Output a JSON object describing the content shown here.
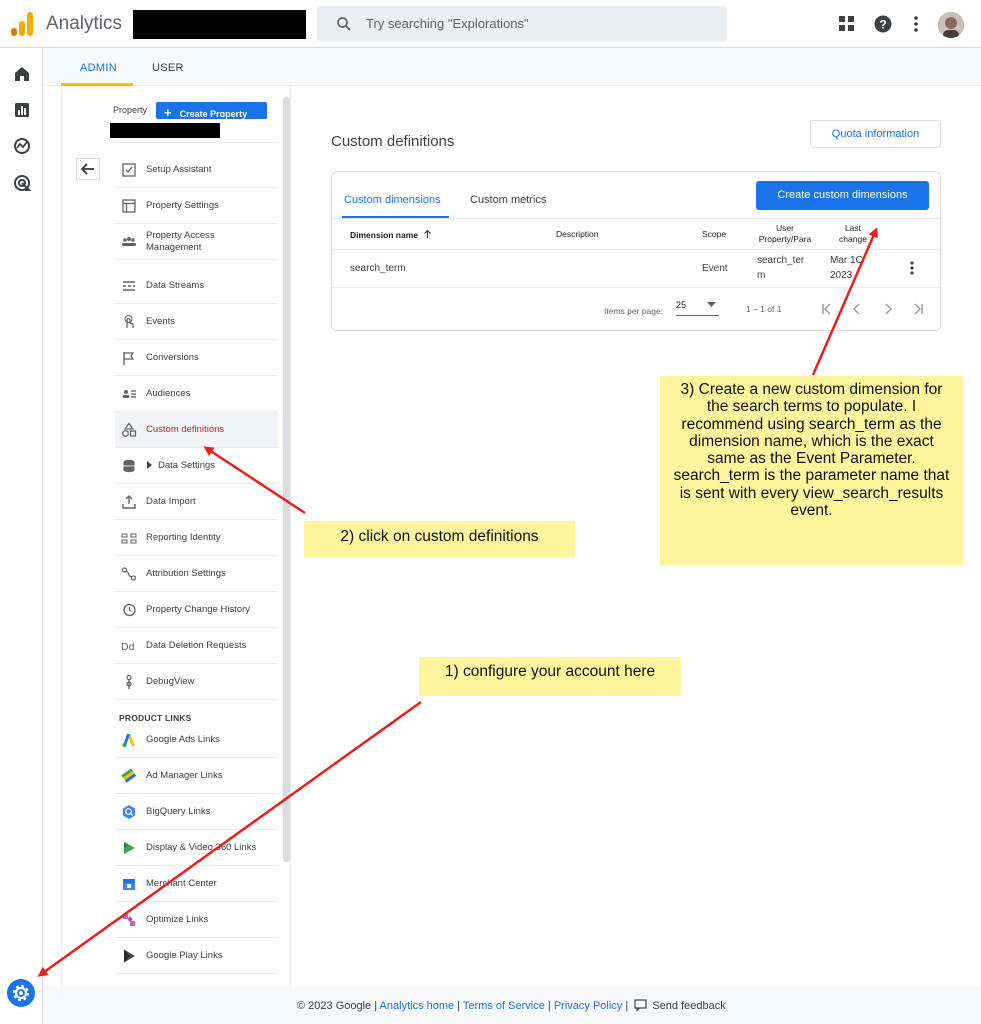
{
  "app": {
    "title": "Analytics"
  },
  "search": {
    "placeholder": "Try searching \"Explorations\""
  },
  "tabs": {
    "admin": "ADMIN",
    "user": "USER"
  },
  "property": {
    "label": "Property",
    "create_button": "Create Property"
  },
  "nav": [
    {
      "label": "Setup Assistant",
      "icon": "checklist-icon"
    },
    {
      "label": "Property Settings",
      "icon": "property-icon"
    },
    {
      "label": "Property Access\nManagement",
      "icon": "people-icon"
    },
    {
      "label": "Data Streams",
      "icon": "streams-icon"
    },
    {
      "label": "Events",
      "icon": "touch-icon"
    },
    {
      "label": "Conversions",
      "icon": "flag-icon"
    },
    {
      "label": "Audiences",
      "icon": "audience-icon"
    },
    {
      "label": "Custom definitions",
      "icon": "shapes-icon"
    },
    {
      "label": "Data Settings",
      "icon": "database-icon"
    },
    {
      "label": "Data Import",
      "icon": "upload-icon"
    },
    {
      "label": "Reporting Identity",
      "icon": "identity-icon"
    },
    {
      "label": "Attribution Settings",
      "icon": "attribution-icon"
    },
    {
      "label": "Property Change History",
      "icon": "history-icon"
    },
    {
      "label": "Data Deletion Requests",
      "icon": "dd-icon"
    },
    {
      "label": "DebugView",
      "icon": "debug-icon"
    }
  ],
  "product_links": {
    "heading": "PRODUCT LINKS",
    "items": [
      {
        "label": "Google Ads Links",
        "icon": "google-ads-icon"
      },
      {
        "label": "Ad Manager Links",
        "icon": "ad-manager-icon"
      },
      {
        "label": "BigQuery Links",
        "icon": "bigquery-icon"
      },
      {
        "label": "Display & Video 360 Links",
        "icon": "dv360-icon"
      },
      {
        "label": "Merchant Center",
        "icon": "merchant-icon"
      },
      {
        "label": "Optimize Links",
        "icon": "optimize-icon"
      },
      {
        "label": "Google Play Links",
        "icon": "play-icon"
      }
    ]
  },
  "main": {
    "title": "Custom definitions",
    "quota_button": "Quota information",
    "tab_dimensions": "Custom dimensions",
    "tab_metrics": "Custom metrics",
    "create_button": "Create custom dimensions",
    "columns": {
      "name": "Dimension name",
      "description": "Description",
      "scope": "Scope",
      "param": "User\nProperty/Para",
      "last_changed": "Last\nchange"
    },
    "row": {
      "name": "search_term",
      "description": "",
      "scope": "Event",
      "param": "search_ter\nm",
      "last_changed": "Mar 1C\n2023"
    },
    "pager": {
      "items_label": "Items per page:",
      "items_value": "25",
      "range": "1 – 1 of 1"
    }
  },
  "notes": {
    "note1": "1) configure your account here",
    "note2": "2) click on custom definitions",
    "note3": "3) Create a new custom dimension for the search terms to populate. I recommend using search_term as the dimension name, which is the exact same as the Event Parameter. search_term is the parameter name that is sent with every view_search_results event."
  },
  "footer": {
    "copyright": "© 2023 Google",
    "analytics_home": "Analytics home",
    "terms": "Terms of Service",
    "privacy": "Privacy Policy",
    "feedback": "Send feedback"
  },
  "colors": {
    "accent": "#1a73e8",
    "note_bg": "#fff59d",
    "arrow": "#e8201d",
    "active_text": "#c5221f"
  }
}
